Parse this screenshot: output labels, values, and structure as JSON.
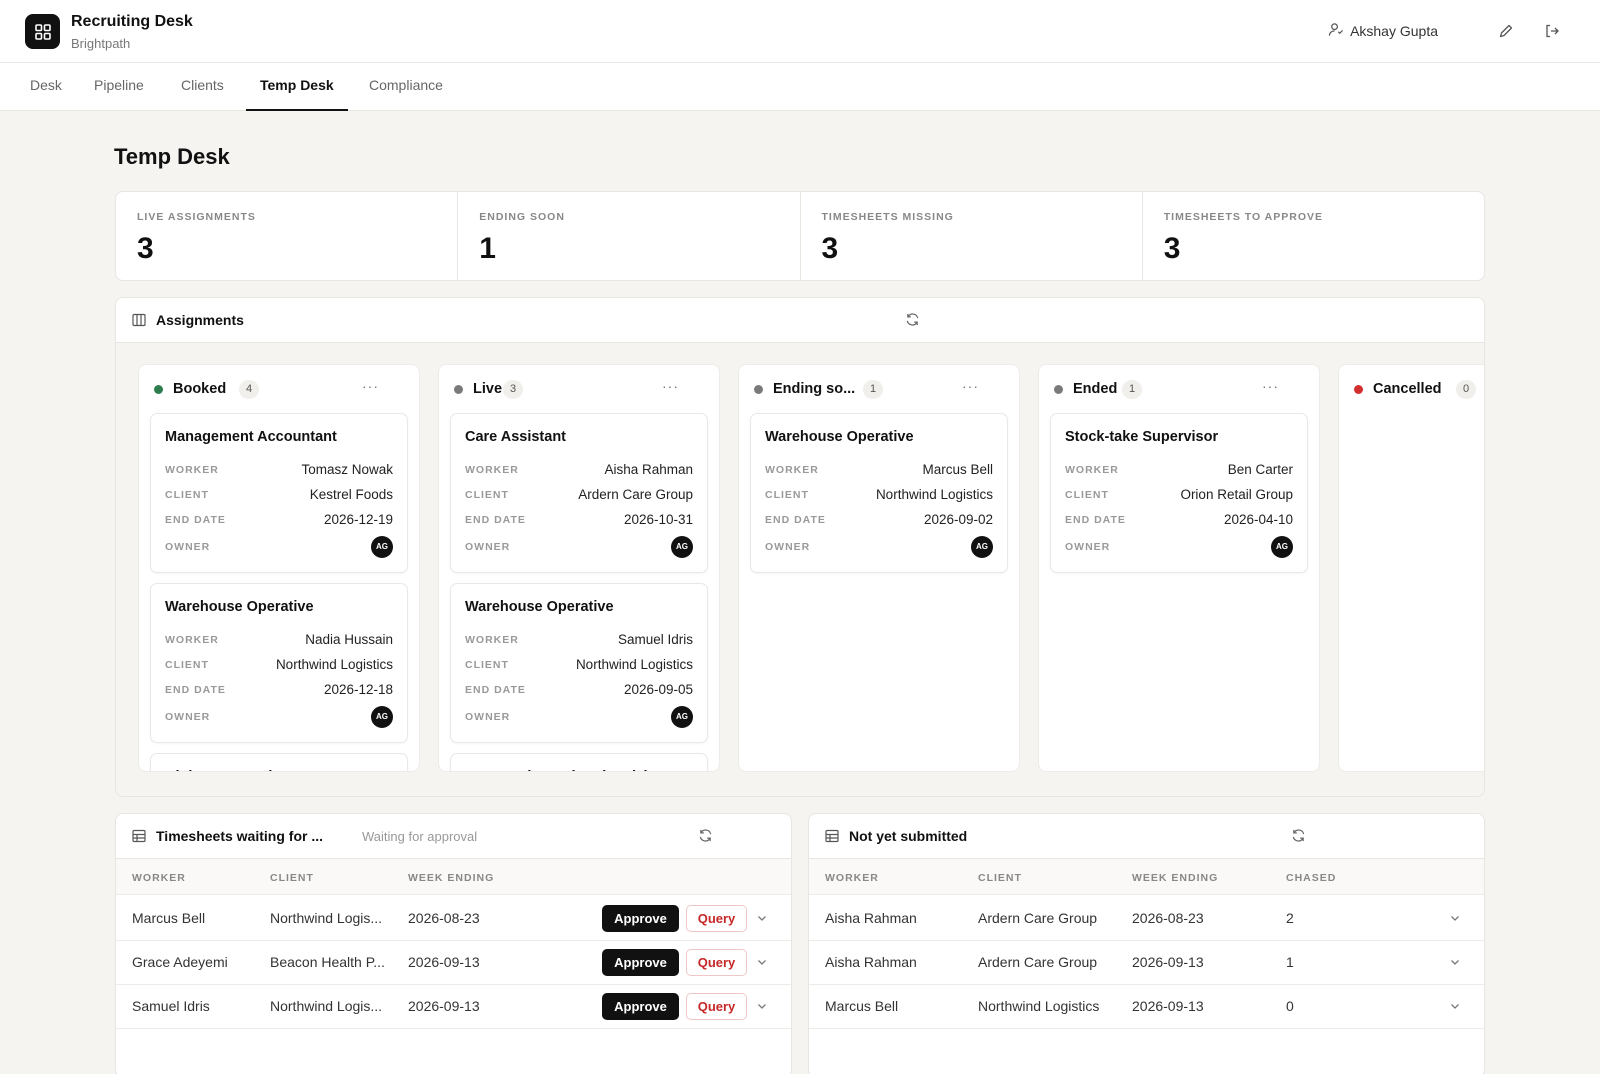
{
  "app": {
    "title": "Recruiting Desk",
    "subtitle": "Brightpath",
    "user": "Akshay Gupta"
  },
  "nav": {
    "tabs": [
      "Desk",
      "Pipeline",
      "Clients",
      "Temp Desk",
      "Compliance"
    ],
    "active": "Temp Desk"
  },
  "page": {
    "title": "Temp Desk"
  },
  "kpis": [
    {
      "label": "LIVE ASSIGNMENTS",
      "value": "3"
    },
    {
      "label": "ENDING SOON",
      "value": "1"
    },
    {
      "label": "TIMESHEETS MISSING",
      "value": "3"
    },
    {
      "label": "TIMESHEETS TO APPROVE",
      "value": "3"
    }
  ],
  "assignments": {
    "title": "Assignments",
    "field_labels": {
      "worker": "WORKER",
      "client": "CLIENT",
      "end_date": "END DATE",
      "owner": "OWNER"
    },
    "columns": [
      {
        "name": "Booked",
        "count": "4",
        "color": "#2e7d4f",
        "more": "···",
        "cards": [
          {
            "title": "Management Accountant",
            "worker": "Tomasz Nowak",
            "client": "Kestrel Foods",
            "end_date": "2026-12-19",
            "owner": "AG"
          },
          {
            "title": "Warehouse Operative",
            "worker": "Nadia Hussain",
            "client": "Northwind Logistics",
            "end_date": "2026-12-18",
            "owner": "AG"
          },
          {
            "title": "Night Care Assistant"
          }
        ]
      },
      {
        "name": "Live",
        "count": "3",
        "color": "#7a7a7a",
        "more": "···",
        "cards": [
          {
            "title": "Care Assistant",
            "worker": "Aisha Rahman",
            "client": "Ardern Care Group",
            "end_date": "2026-10-31",
            "owner": "AG"
          },
          {
            "title": "Warehouse Operative",
            "worker": "Samuel Idris",
            "client": "Northwind Logistics",
            "end_date": "2026-09-05",
            "owner": "AG"
          },
          {
            "title": "Care Assistant (weekends)"
          }
        ]
      },
      {
        "name": "Ending so...",
        "count": "1",
        "color": "#7a7a7a",
        "more": "···",
        "cards": [
          {
            "title": "Warehouse Operative",
            "worker": "Marcus Bell",
            "client": "Northwind Logistics",
            "end_date": "2026-09-02",
            "owner": "AG"
          }
        ]
      },
      {
        "name": "Ended",
        "count": "1",
        "color": "#7a7a7a",
        "more": "···",
        "cards": [
          {
            "title": "Stock-take Supervisor",
            "worker": "Ben Carter",
            "client": "Orion Retail Group",
            "end_date": "2026-04-10",
            "owner": "AG"
          }
        ]
      },
      {
        "name": "Cancelled",
        "count": "0",
        "color": "#d32f2f",
        "more": "",
        "cards": []
      }
    ]
  },
  "timesheets_approval": {
    "title": "Timesheets waiting for ...",
    "subtitle": "Waiting for approval",
    "headers": [
      "WORKER",
      "CLIENT",
      "WEEK ENDING"
    ],
    "approve_label": "Approve",
    "query_label": "Query",
    "rows": [
      {
        "worker": "Marcus Bell",
        "client": "Northwind Logis...",
        "week_ending": "2026-08-23"
      },
      {
        "worker": "Grace Adeyemi",
        "client": "Beacon Health P...",
        "week_ending": "2026-09-13"
      },
      {
        "worker": "Samuel Idris",
        "client": "Northwind Logis...",
        "week_ending": "2026-09-13"
      }
    ]
  },
  "not_submitted": {
    "title": "Not yet submitted",
    "headers": [
      "WORKER",
      "CLIENT",
      "WEEK ENDING",
      "CHASED"
    ],
    "rows": [
      {
        "worker": "Aisha Rahman",
        "client": "Ardern Care Group",
        "week_ending": "2026-08-23",
        "chased": "2"
      },
      {
        "worker": "Aisha Rahman",
        "client": "Ardern Care Group",
        "week_ending": "2026-09-13",
        "chased": "1"
      },
      {
        "worker": "Marcus Bell",
        "client": "Northwind Logistics",
        "week_ending": "2026-09-13",
        "chased": "0"
      }
    ]
  },
  "icons": {
    "logo": "grid-icon",
    "user": "user-icon",
    "edit": "pencil-icon",
    "logout": "logout-icon",
    "refresh": "refresh-icon",
    "columns": "columns-icon",
    "table": "table-icon",
    "chevron": "chevron-down-icon"
  }
}
